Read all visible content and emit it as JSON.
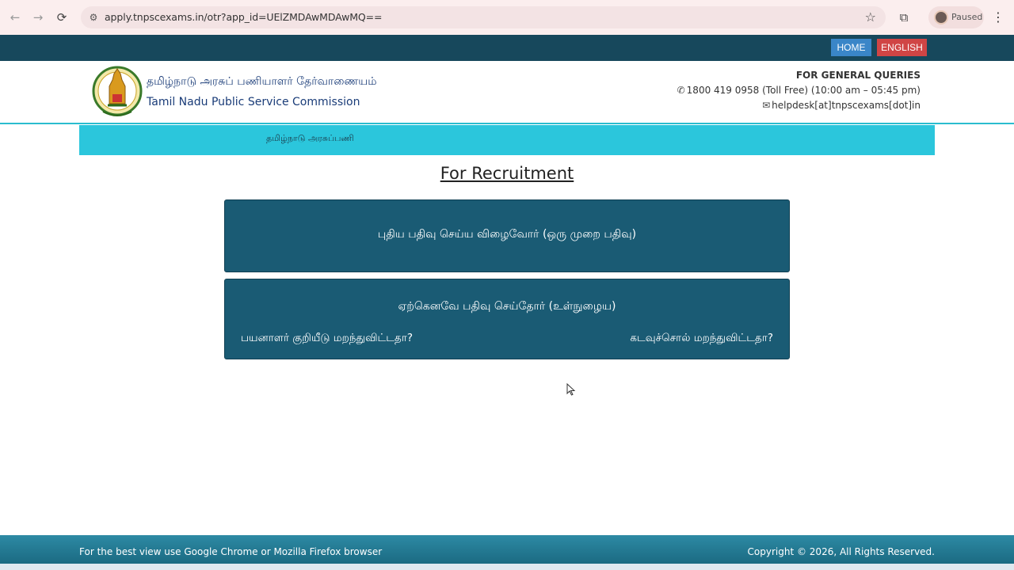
{
  "browser": {
    "url": "apply.tnpscexams.in/otr?app_id=UElZMDAwMDAwMQ==",
    "profile_label": "Paused"
  },
  "topbar": {
    "home_label": "HOME",
    "language_label": "ENGLISH"
  },
  "header": {
    "org_name_tamil": "தமிழ்நாடு அரசுப் பணியாளர் தேர்வாணையம்",
    "org_name_english": "Tamil Nadu Public Service Commission",
    "queries_title": "FOR GENERAL QUERIES",
    "phone": "1800 419 0958 (Toll Free) (10:00 am – 05:45 pm)",
    "email": "helpdesk[at]tnpscexams[dot]in"
  },
  "band": {
    "text": "தமிழ்நாடு அரசுப்பணி"
  },
  "main": {
    "section_title": "For Recruitment",
    "new_registration_label": "புதிய பதிவு செய்ய விழைவோர் (ஒரு முறை பதிவு)",
    "existing_login_label": "ஏற்கெனவே பதிவு செய்தோர் (உள்நுழைய)",
    "forgot_userid_label": "பயனாளர் குறியீடு மறந்துவிட்டதா?",
    "forgot_password_label": "கடவுச்சொல் மறந்துவிட்டதா?"
  },
  "footer": {
    "browser_note": "For the best view use Google Chrome or Mozilla Firefox browser",
    "copyright": "Copyright © 2026, All Rights Reserved."
  }
}
